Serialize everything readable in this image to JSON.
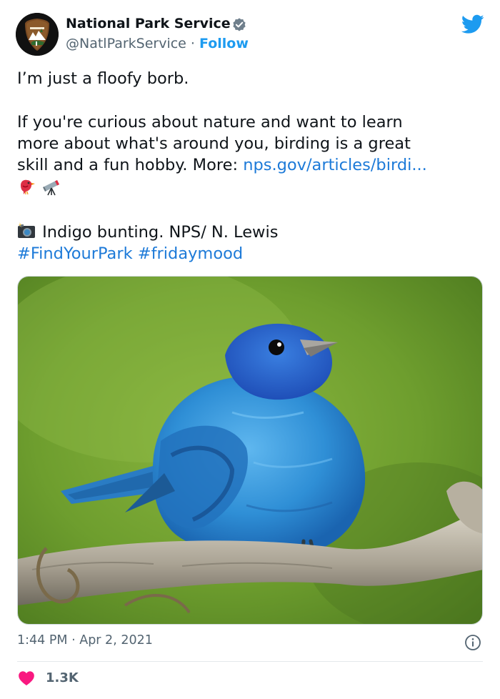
{
  "header": {
    "display_name": "National Park Service",
    "handle": "@NatlParkService",
    "separator": " · ",
    "follow_label": "Follow",
    "avatar_icon": "nps-arrowhead-logo",
    "verified_icon": "verified-badge-icon",
    "platform_icon": "twitter-bird-icon"
  },
  "tweet": {
    "line1": "I’m just a floofy borb.",
    "para2_line1": "If you're curious about nature and want to learn",
    "para2_line2": "more about what's around you, birding is a great",
    "para2_line3_prefix": "skill and a fun hobby. More: ",
    "para2_link": "nps.gov/articles/birdi...",
    "emojis": [
      "bird-emoji",
      "telescope-emoji"
    ],
    "camera_emoji": "camera-with-flash-emoji",
    "caption": "Indigo bunting. NPS/ N. Lewis",
    "hashtags": [
      "#FindYourPark",
      "#fridaymood"
    ]
  },
  "media": {
    "description_icon": "indigo-bunting-photo"
  },
  "meta": {
    "time": "1:44 PM",
    "separator": " · ",
    "date": "Apr 2, 2021",
    "info_icon": "info-icon"
  },
  "engagement": {
    "likes": "1.3K",
    "like_icon": "heart-icon"
  },
  "colors": {
    "link": "#1d9bf0",
    "text": "#0f1419",
    "muted": "#536471",
    "heart": "#f91880"
  }
}
